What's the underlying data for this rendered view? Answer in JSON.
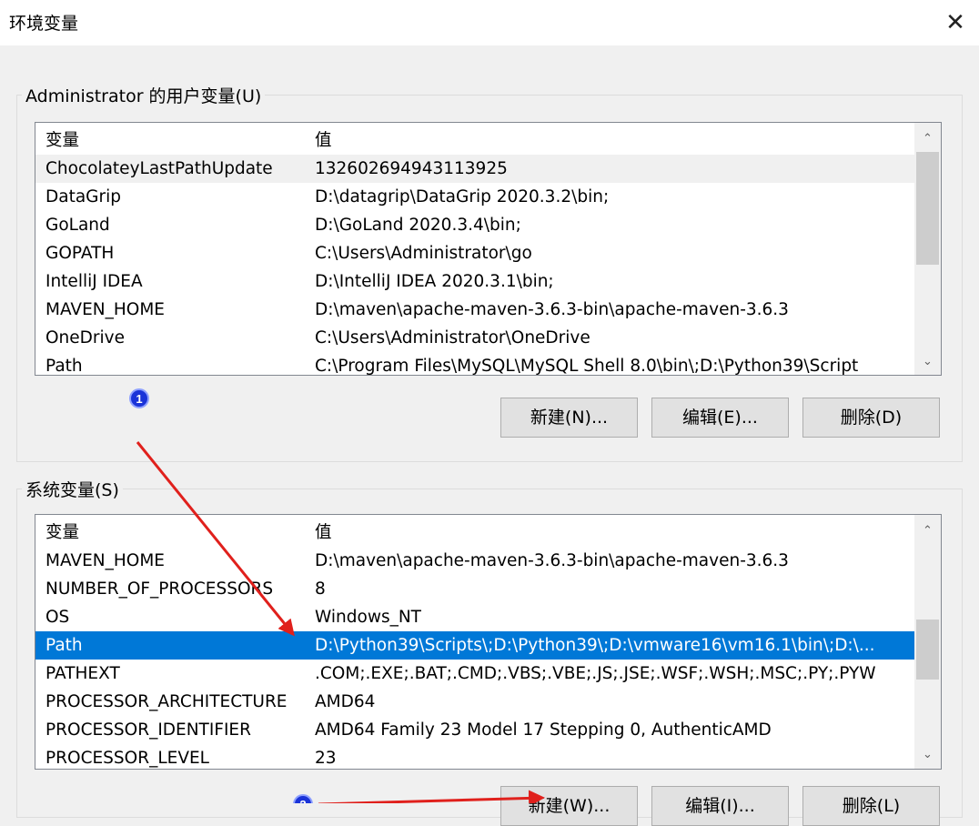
{
  "dialog": {
    "title": "环境变量",
    "close_glyph": "✕"
  },
  "user_vars": {
    "legend": "Administrator 的用户变量(U)",
    "col_name": "变量",
    "col_value": "值",
    "rows": [
      {
        "name": "ChocolateyLastPathUpdate",
        "value": "132602694943113925"
      },
      {
        "name": "DataGrip",
        "value": "D:\\datagrip\\DataGrip 2020.3.2\\bin;"
      },
      {
        "name": "GoLand",
        "value": "D:\\GoLand 2020.3.4\\bin;"
      },
      {
        "name": "GOPATH",
        "value": "C:\\Users\\Administrator\\go"
      },
      {
        "name": "IntelliJ IDEA",
        "value": "D:\\IntelliJ IDEA 2020.3.1\\bin;"
      },
      {
        "name": "MAVEN_HOME",
        "value": "D:\\maven\\apache-maven-3.6.3-bin\\apache-maven-3.6.3"
      },
      {
        "name": "OneDrive",
        "value": "C:\\Users\\Administrator\\OneDrive"
      },
      {
        "name": "Path",
        "value": "C:\\Program Files\\MySQL\\MySQL Shell 8.0\\bin\\;D:\\Python39\\Script"
      }
    ],
    "buttons": {
      "new": "新建(N)...",
      "edit": "编辑(E)...",
      "delete": "删除(D)"
    },
    "scroll_position": 0
  },
  "system_vars": {
    "legend": "系统变量(S)",
    "col_name": "变量",
    "col_value": "值",
    "rows": [
      {
        "name": "MAVEN_HOME",
        "value": "D:\\maven\\apache-maven-3.6.3-bin\\apache-maven-3.6.3"
      },
      {
        "name": "NUMBER_OF_PROCESSORS",
        "value": "8"
      },
      {
        "name": "OS",
        "value": "Windows_NT"
      },
      {
        "name": "Path",
        "value": "D:\\Python39\\Scripts\\;D:\\Python39\\;D:\\vmware16\\vm16.1\\bin\\;D:\\...",
        "selected": true
      },
      {
        "name": "PATHEXT",
        "value": ".COM;.EXE;.BAT;.CMD;.VBS;.VBE;.JS;.JSE;.WSF;.WSH;.MSC;.PY;.PYW"
      },
      {
        "name": "PROCESSOR_ARCHITECTURE",
        "value": "AMD64"
      },
      {
        "name": "PROCESSOR_IDENTIFIER",
        "value": "AMD64 Family 23 Model 17 Stepping 0, AuthenticAMD"
      },
      {
        "name": "PROCESSOR_LEVEL",
        "value": "23"
      }
    ],
    "buttons": {
      "new": "新建(W)...",
      "edit": "编辑(I)...",
      "delete": "删除(L)"
    },
    "scroll_position": 0.55
  },
  "annotations": {
    "marker_1": "1",
    "marker_2": "2",
    "arrow_color": "#e0201c",
    "marker_color": "#1a33d8"
  },
  "colors": {
    "selection": "#0078d7",
    "dialog_bg": "#f0f0f0"
  }
}
